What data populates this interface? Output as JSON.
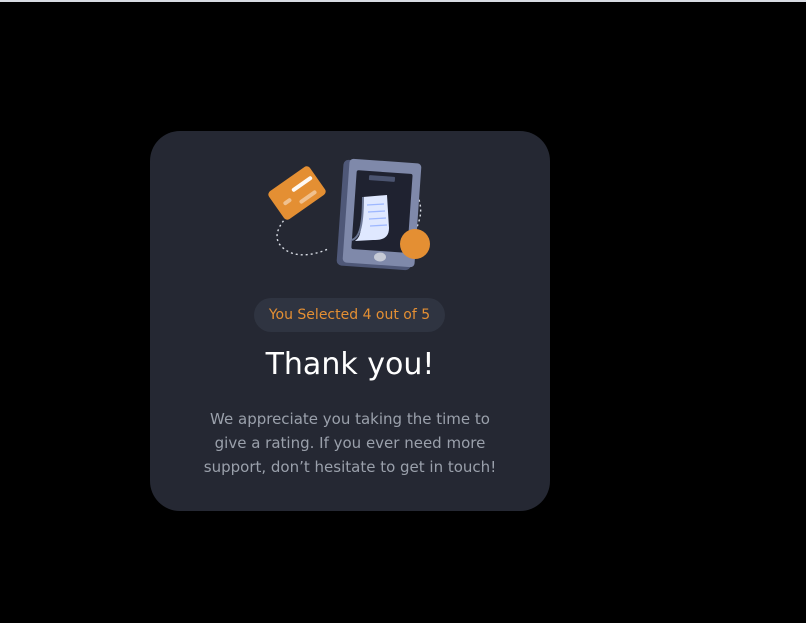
{
  "page": {
    "background_color": "#000000",
    "top_line_color": "#d7dbe2"
  },
  "card": {
    "background_color": "#252833",
    "illustration_name": "payment-receipt-illustration",
    "rating_text": "You Selected 4 out of 5",
    "rating_color": "#e48f33",
    "title": "Thank you!",
    "message": "We appreciate you taking the time to give a rating. If you ever need more support, don’t hesitate to get in touch!"
  }
}
